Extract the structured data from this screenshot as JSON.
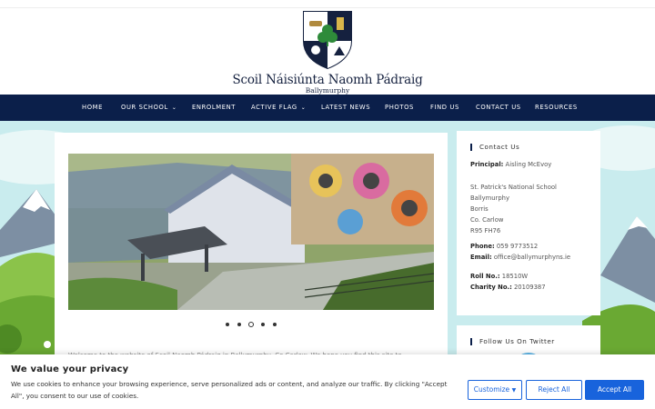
{
  "school": {
    "name": "Scoil Náisiúnta Naomh Pádraig",
    "subtitle": "Ballymurphy"
  },
  "nav": {
    "items": [
      {
        "label": "HOME"
      },
      {
        "label": "OUR SCHOOL",
        "dropdown": true
      },
      {
        "label": "ENROLMENT"
      },
      {
        "label": "ACTIVE FLAG",
        "dropdown": true
      },
      {
        "label": "LATEST NEWS"
      },
      {
        "label": "PHOTOS"
      },
      {
        "label": "FIND US"
      },
      {
        "label": "CONTACT US"
      },
      {
        "label": "RESOURCES"
      }
    ]
  },
  "slider": {
    "dot_count": 5,
    "active_index": 2
  },
  "main": {
    "welcome_text": "Welcome to the website of Scoil Naomh Pádraig in Ballymurphy, Co Carlow. We hope you find this site to..."
  },
  "contact": {
    "title": "Contact Us",
    "principal_label": "Principal:",
    "principal_value": "Aisling McEvoy",
    "address_lines": [
      "St. Patrick's National School",
      "Ballymurphy",
      "Borris",
      "Co. Carlow",
      "R95 FH76"
    ],
    "phone_label": "Phone:",
    "phone_value": "059 9773512",
    "email_label": "Email:",
    "email_value": "office@ballymurphyns.ie",
    "roll_label": "Roll No.:",
    "roll_value": "18510W",
    "charity_label": "Charity No.:",
    "charity_value": "20109387"
  },
  "twitter": {
    "title": "Follow Us On Twitter"
  },
  "cookie": {
    "title": "We value your privacy",
    "text": "We use cookies to enhance your browsing experience, serve personalized ads or content, and analyze our traffic. By clicking \"Accept All\", you consent to our use of cookies.",
    "customize_label": "Customize",
    "reject_label": "Reject All",
    "accept_label": "Accept All"
  },
  "colors": {
    "nav_bg": "#0b1f4a",
    "accent": "#1863dc"
  }
}
